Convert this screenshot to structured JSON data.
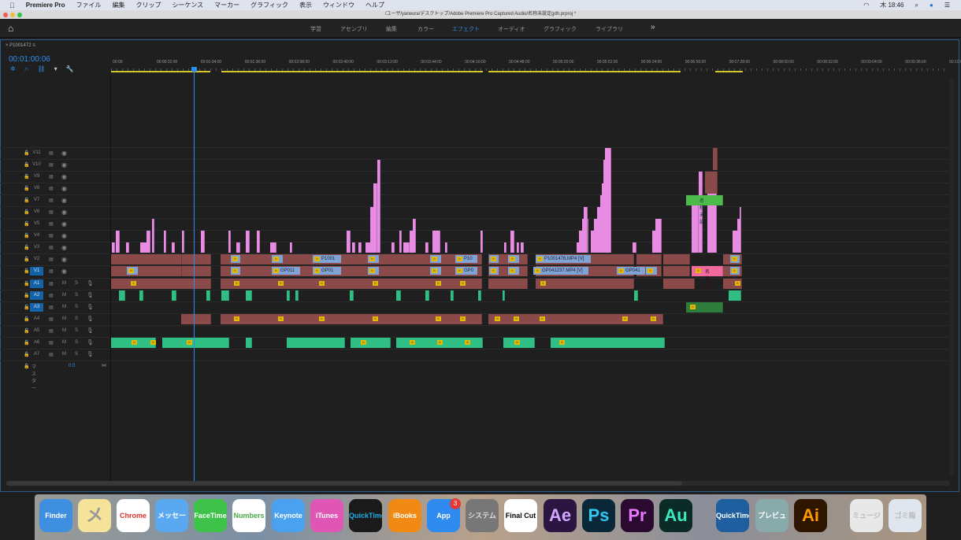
{
  "menubar": {
    "app": "Premiere Pro",
    "items": [
      "ファイル",
      "編集",
      "クリップ",
      "シーケンス",
      "マーカー",
      "グラフィック",
      "表示",
      "ウィンドウ",
      "ヘルプ"
    ],
    "clock": "木 18:46"
  },
  "window": {
    "title": "/ユーザ/yaneura/デスクトップ/Adobe Premiere Pro Captured Audio/名称未設定gdh.prproj *"
  },
  "workspaces": {
    "tabs": [
      "学習",
      "アセンブリ",
      "編集",
      "カラー",
      "エフェクト",
      "オーディオ",
      "グラフィック",
      "ライブラリ"
    ],
    "active": "エフェクト",
    "more": "»"
  },
  "sequence": {
    "name": "P1001472",
    "timecode": "00:01:00:06"
  },
  "ruler": [
    "00:00",
    "00:00:32:00",
    "00:01:04:00",
    "00:01:36:00",
    "00:02:08:00",
    "00:02:40:00",
    "00:03:12:00",
    "00:03:44:00",
    "00:04:16:00",
    "00:04:48:00",
    "00:05:20:00",
    "00:05:52:00",
    "00:06:24:00",
    "00:06:56:00",
    "00:07:28:00",
    "00:08:00:00",
    "00:08:32:00",
    "00:09:04:00",
    "00:09:36:00",
    "00:10:0"
  ],
  "video_tracks": [
    "V11",
    "V10",
    "V9",
    "V8",
    "V7",
    "V6",
    "V5",
    "V4",
    "V3",
    "V2",
    "V1"
  ],
  "audio_tracks": [
    "A1",
    "A2",
    "A3",
    "A4",
    "A5",
    "A6",
    "A7"
  ],
  "audio_buttons": {
    "mute": "M",
    "solo": "S"
  },
  "master": {
    "label": "マスター",
    "value": "0.0"
  },
  "clip_labels": {
    "v2a": "P1001",
    "v2b": "P10",
    "v2c": "P1001476.MP4 [V]",
    "v1a": "GP011",
    "v1b": "GP01",
    "v1c": "GP0",
    "v1d": "GP041237.MP4 [V]",
    "v1e": "GP041",
    "title1": "名称未設",
    "title2": "名称未",
    "fx": "fx"
  },
  "dock": {
    "apps": [
      "Finder",
      "メモ",
      "Chrome",
      "メッセージ",
      "FaceTime",
      "Numbers",
      "Keynote",
      "iTunes",
      "QuickTime",
      "iBooks",
      "App Store",
      "システム環境設定",
      "Final Cut",
      "Ae",
      "Ps",
      "Pr",
      "Au",
      "QuickTime Player",
      "プレビュー",
      "Ai",
      "ミュージック",
      "ゴミ箱"
    ],
    "appstore_badge": "3"
  },
  "colors": {
    "accent": "#2d8ceb",
    "video_clip": "#8b4a4a",
    "clip_label": "#7fa3d4",
    "adjust_pink": "#e78be3",
    "audio_clip": "#2fbf84",
    "title_green": "#4cbb4c"
  }
}
